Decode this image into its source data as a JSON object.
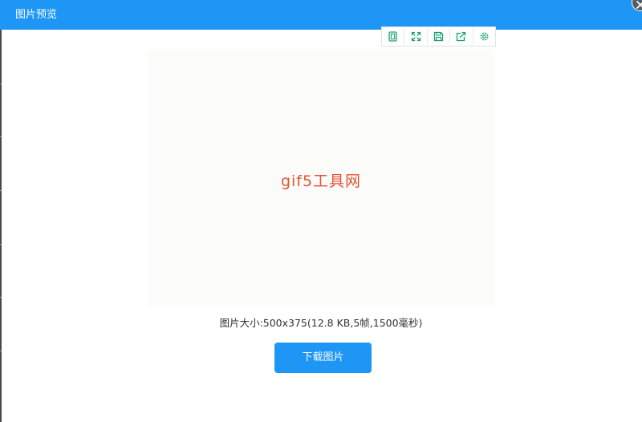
{
  "window": {
    "title": "图片预览"
  },
  "toolbar": {
    "tools": [
      {
        "icon": "crop-icon"
      },
      {
        "icon": "expand-icon"
      },
      {
        "icon": "save-icon"
      },
      {
        "icon": "share-icon"
      },
      {
        "icon": "gear-icon"
      }
    ],
    "accent": "#1aa06d"
  },
  "preview": {
    "text": "gif5工具网",
    "text_color": "#e25432"
  },
  "info": {
    "text": "图片大小:500x375(12.8 KB,5帧,1500毫秒)"
  },
  "actions": {
    "download_label": "下载图片"
  },
  "colors": {
    "titlebar": "#1e96f5",
    "button": "#1e96f5"
  }
}
